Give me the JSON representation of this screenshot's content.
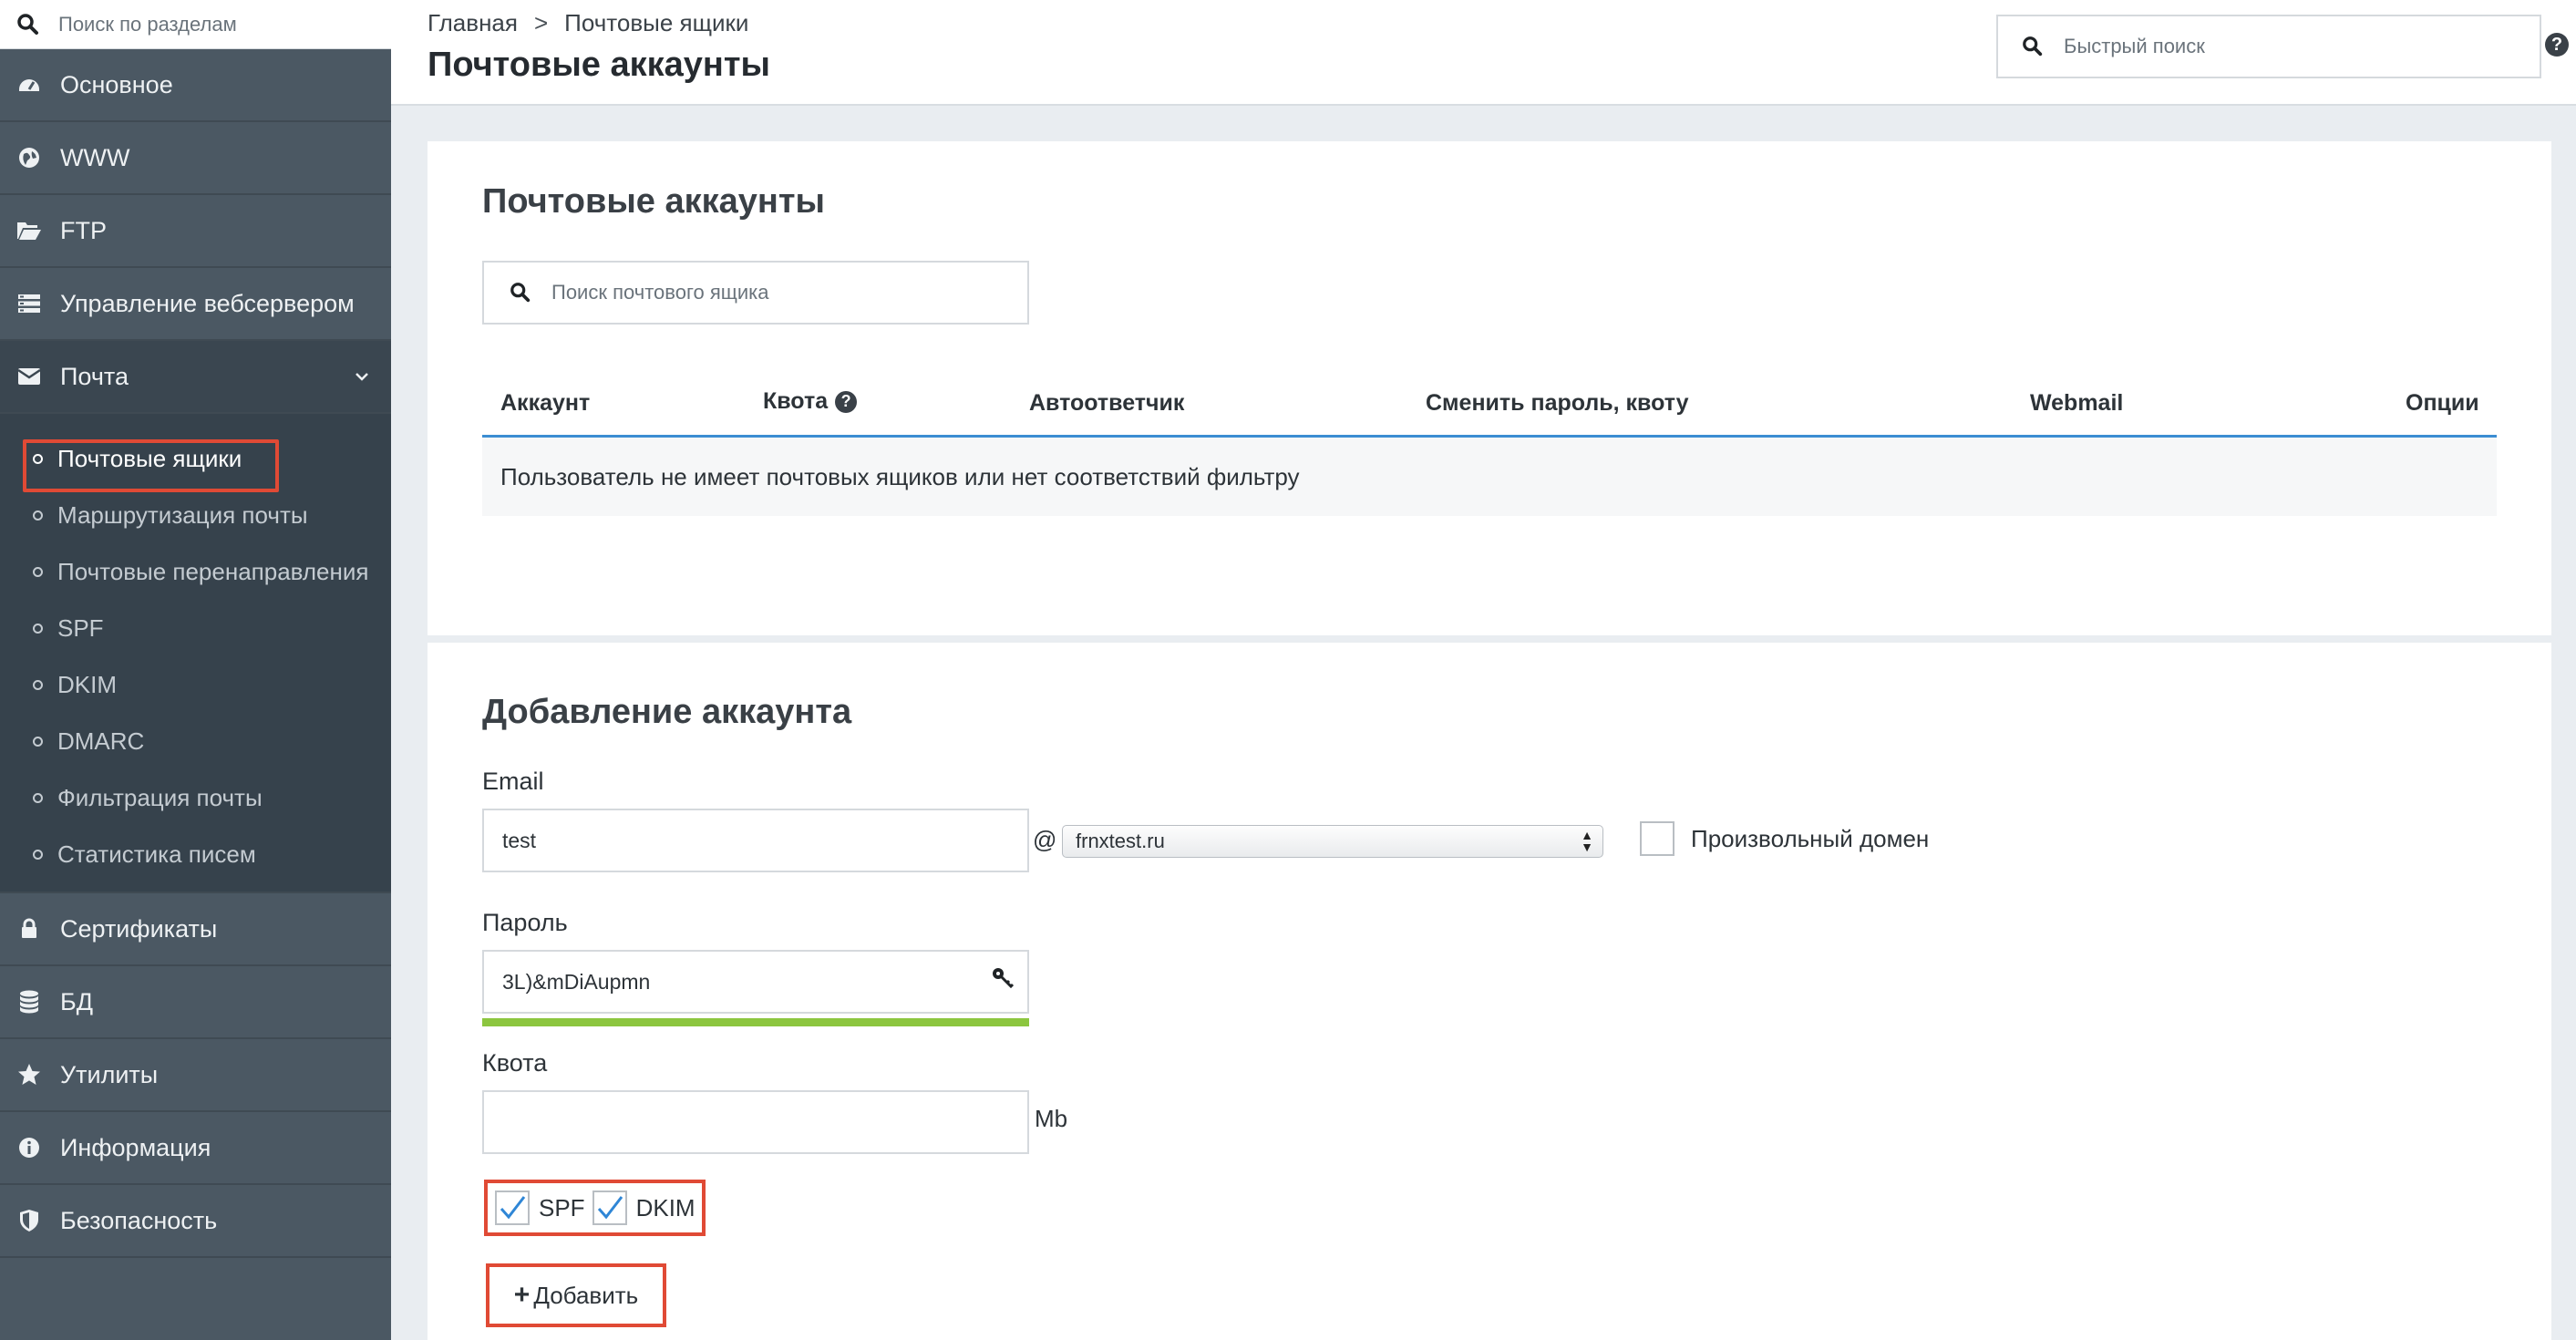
{
  "sidebar": {
    "search_placeholder": "Поиск по разделам",
    "items": [
      {
        "label": "Основное",
        "icon": "dashboard-icon"
      },
      {
        "label": "WWW",
        "icon": "globe-icon"
      },
      {
        "label": "FTP",
        "icon": "folder-open-icon"
      },
      {
        "label": "Управление вебсервером",
        "icon": "server-icon"
      },
      {
        "label": "Почта",
        "icon": "envelope-icon"
      }
    ],
    "mail_sub": [
      {
        "label": "Почтовые ящики"
      },
      {
        "label": "Маршрутизация почты"
      },
      {
        "label": "Почтовые перенаправления"
      },
      {
        "label": "SPF"
      },
      {
        "label": "DKIM"
      },
      {
        "label": "DMARC"
      },
      {
        "label": "Фильтрация почты"
      },
      {
        "label": "Статистика писем"
      }
    ],
    "items_after": [
      {
        "label": "Сертификаты",
        "icon": "lock-icon"
      },
      {
        "label": "БД",
        "icon": "database-icon"
      },
      {
        "label": "Утилиты",
        "icon": "star-icon"
      },
      {
        "label": "Информация",
        "icon": "info-icon"
      },
      {
        "label": "Безопасность",
        "icon": "shield-icon"
      }
    ]
  },
  "header": {
    "breadcrumb": [
      "Главная",
      "Почтовые ящики"
    ],
    "breadcrumb_sep": ">",
    "title": "Почтовые аккаунты",
    "quick_search_placeholder": "Быстрый поиск",
    "help": "?"
  },
  "accounts": {
    "title": "Почтовые аккаунты",
    "search_placeholder": "Поиск почтового ящика",
    "columns": [
      "Аккаунт",
      "Квота",
      "Автоответчик",
      "Сменить пароль, квоту",
      "Webmail",
      "Опции"
    ],
    "empty_message": "Пользователь не имеет почтовых ящиков или нет соответствий фильтру"
  },
  "add_account": {
    "title": "Добавление аккаунта",
    "email_label": "Email",
    "email_value": "test",
    "at": "@",
    "domain_value": "frnxtest.ru",
    "custom_domain_label": "Произвольный домен",
    "password_label": "Пароль",
    "password_value": "3L)&mDiAupmn",
    "password_strength": 1.0,
    "quota_label": "Квота",
    "quota_value": "",
    "quota_unit": "Mb",
    "spf_label": "SPF",
    "spf_checked": true,
    "dkim_label": "DKIM",
    "dkim_checked": true,
    "add_button": "Добавить"
  },
  "colors": {
    "sidebar_bg": "#4b5863",
    "highlight": "#e04a35",
    "accent_blue": "#3b8dd2",
    "strength_green": "#8cc63f"
  }
}
